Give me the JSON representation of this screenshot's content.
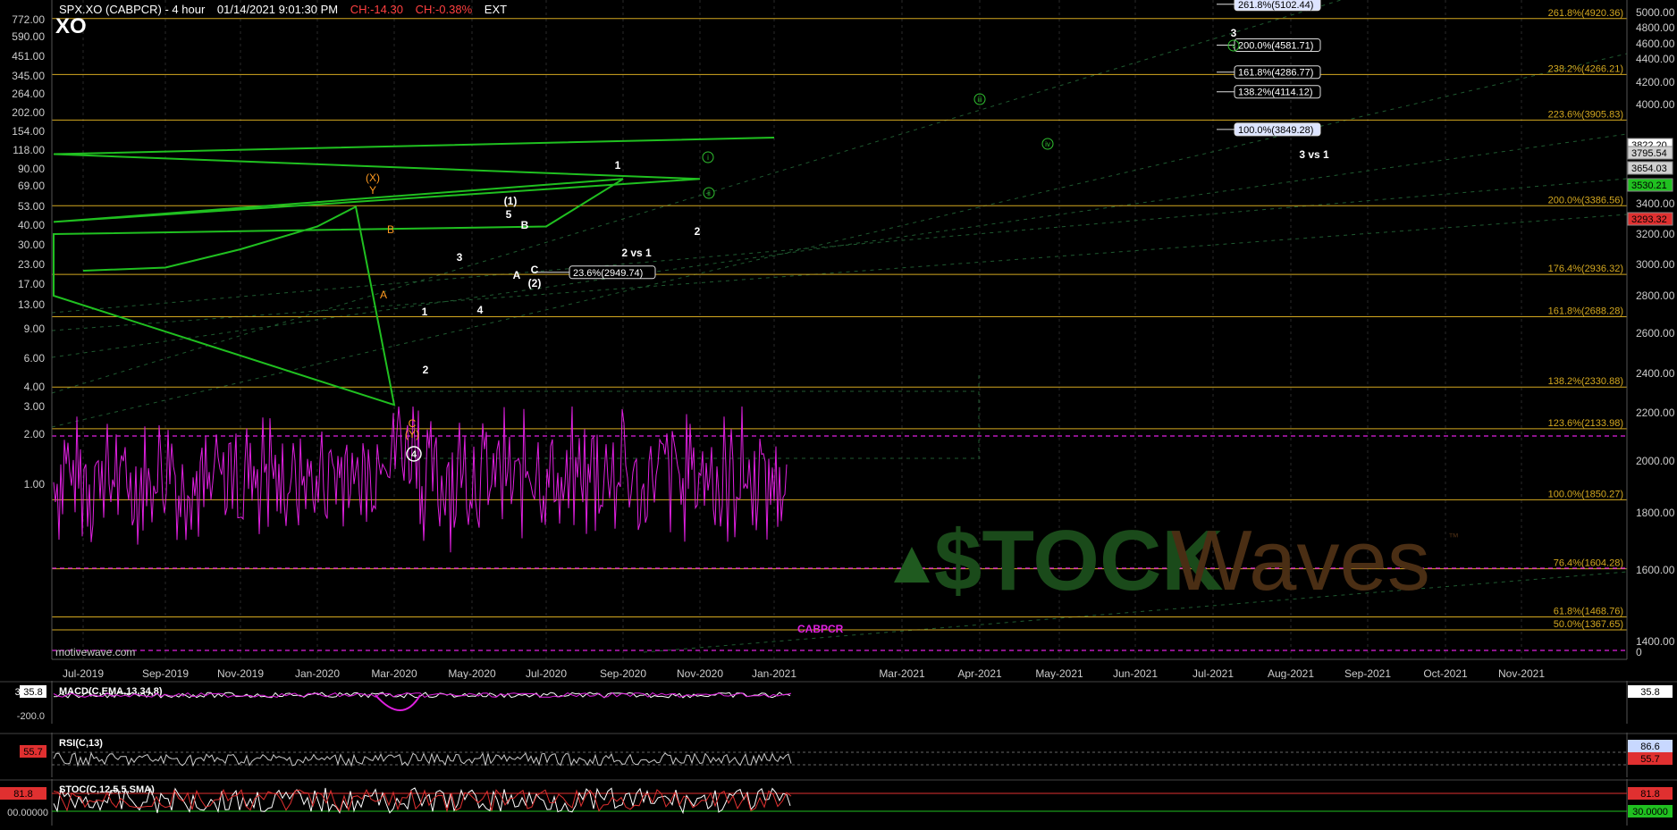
{
  "header": {
    "symbol": "SPX.XO (CABPCR) - 4 hour",
    "datetime": "01/14/2021 9:01:30 PM",
    "change": "CH:-14.30",
    "change_pct": "CH:-0.38%",
    "session": "EXT",
    "short_symbol": "XO",
    "watermark": "motivewave.com"
  },
  "logo": {
    "text_left": "$TOCK",
    "text_right": "Waves",
    "tm": "™"
  },
  "colors": {
    "background": "#000000",
    "fib_line": "#d4a820",
    "fib_label": "#d4a820",
    "indicator": "#e020e0",
    "price_up": "#20c020",
    "price_down": "#e03030",
    "orange_label": "#ff9a20",
    "green_label": "#30c030"
  },
  "chart_data": [
    {
      "type": "line",
      "title": "SPX.XO (CABPCR) - 4 hour",
      "x_axis_ticks": [
        "Jul-2019",
        "Sep-2019",
        "Nov-2019",
        "Jan-2020",
        "Mar-2020",
        "May-2020",
        "Jul-2020",
        "Sep-2020",
        "Nov-2020",
        "Jan-2021",
        "Mar-2021",
        "Apr-2021",
        "May-2021",
        "Jun-2021",
        "Jul-2021",
        "Aug-2021",
        "Sep-2021",
        "Oct-2021",
        "Nov-2021"
      ],
      "left_axis_ticks": [
        "772.00",
        "590.00",
        "451.00",
        "345.00",
        "264.00",
        "202.00",
        "154.00",
        "118.00",
        "90.00",
        "69.00",
        "53.00",
        "40.00",
        "30.00",
        "23.00",
        "17.00",
        "13.00",
        "9.00",
        "6.00",
        "4.00",
        "3.00",
        "2.00",
        "1.00"
      ],
      "right_axis_ticks": [
        "5000.00",
        "4800.00",
        "4600.00",
        "4400.00",
        "4200.00",
        "4000.00",
        "3400.00",
        "3200.00",
        "3000.00",
        "2800.00",
        "2600.00",
        "2400.00",
        "2200.00",
        "2000.00",
        "1800.00",
        "1600.00",
        "1400.00",
        "0"
      ],
      "right_price_tags": [
        {
          "label": "3822.20",
          "color": "#ffffff"
        },
        {
          "label": "3795.54",
          "color": "#d0d0d0"
        },
        {
          "label": "3654.03",
          "color": "#d0d0d0"
        },
        {
          "label": "3530.21",
          "color": "#20c020"
        },
        {
          "label": "3293.32",
          "color": "#e03030"
        }
      ],
      "fib_levels": [
        {
          "label": "261.8%(4920.36)",
          "value": 4920.36
        },
        {
          "label": "238.2%(4266.21)",
          "value": 4266.21
        },
        {
          "label": "223.6%(3905.83)",
          "value": 3905.83
        },
        {
          "label": "200.0%(3386.56)",
          "value": 3386.56
        },
        {
          "label": "176.4%(2936.32)",
          "value": 2936.32
        },
        {
          "label": "161.8%(2688.28)",
          "value": 2688.28
        },
        {
          "label": "138.2%(2330.88)",
          "value": 2330.88
        },
        {
          "label": "123.6%(2133.98)",
          "value": 2133.98
        },
        {
          "label": "100.0%(1850.27)",
          "value": 1850.27
        },
        {
          "label": "76.4%(1604.28)",
          "value": 1604.28
        },
        {
          "label": "61.8%(1468.76)",
          "value": 1468.76
        },
        {
          "label": "50.0%(1367.65)",
          "value": 1367.65
        }
      ],
      "target_boxes": [
        {
          "label": "261.8%(5102.44)",
          "value": 5102.44
        },
        {
          "label": "200.0%(4581.71)",
          "value": 4581.71
        },
        {
          "label": "161.8%(4286.77)",
          "value": 4286.77
        },
        {
          "label": "138.2%(4114.12)",
          "value": 4114.12
        },
        {
          "label": "100.0%(3849.28)",
          "value": 3849.28
        },
        {
          "label": "23.6%(2949.74)",
          "value": 2949.74
        }
      ],
      "wave_labels": {
        "orange": [
          "(X)",
          "Y",
          "B",
          "A",
          "C",
          "(Y)"
        ],
        "white": [
          "1",
          "2",
          "3",
          "4",
          "(1)",
          "5",
          "B",
          "A",
          "C",
          "(2)",
          "1",
          "2 vs 1",
          "1",
          "2",
          "3",
          "3 vs 1"
        ],
        "green": [
          "i",
          "ii",
          "iii",
          "iv",
          "v"
        ],
        "circled": [
          "4"
        ]
      },
      "indicator_series": {
        "name": "CABPCR",
        "color": "#e020e0",
        "approx_range": [
          0.4,
          4.0
        ],
        "dashed_levels": [
          2.0,
          0.6,
          0.35
        ]
      },
      "price_series": {
        "x": [
          "Jul-2019",
          "Sep-2019",
          "Nov-2019",
          "Jan-2020",
          "Feb-2020",
          "Mar-2020",
          "Apr-2020",
          "Jun-2020",
          "Jul-2020",
          "Sep-2020",
          "Oct-2020",
          "Nov-2020",
          "Dec-2020",
          "Jan-2021"
        ],
        "y": [
          2960,
          2980,
          3100,
          3250,
          3380,
          2240,
          2800,
          3200,
          3250,
          3550,
          3280,
          3550,
          3700,
          3800
        ]
      }
    },
    {
      "type": "line",
      "title": "MACD(C,EMA,13,34,8)",
      "axis_labels": [
        "35.8",
        "-200.0"
      ],
      "current_value": "35.8"
    },
    {
      "type": "line",
      "title": "RSI(C,13)",
      "tags": [
        {
          "label": "86.6",
          "color": "#c8d8ff"
        },
        {
          "label": "55.7",
          "color": "#e03030"
        }
      ],
      "current_value": "55.7"
    },
    {
      "type": "line",
      "title": "STOC(C,12,5,5,SMA)",
      "tags": [
        {
          "label": "81.8",
          "color": "#e03030"
        },
        {
          "label": "30.0000",
          "color": "#20c020"
        }
      ],
      "left_values": [
        "81.8",
        "00.00000"
      ]
    }
  ]
}
